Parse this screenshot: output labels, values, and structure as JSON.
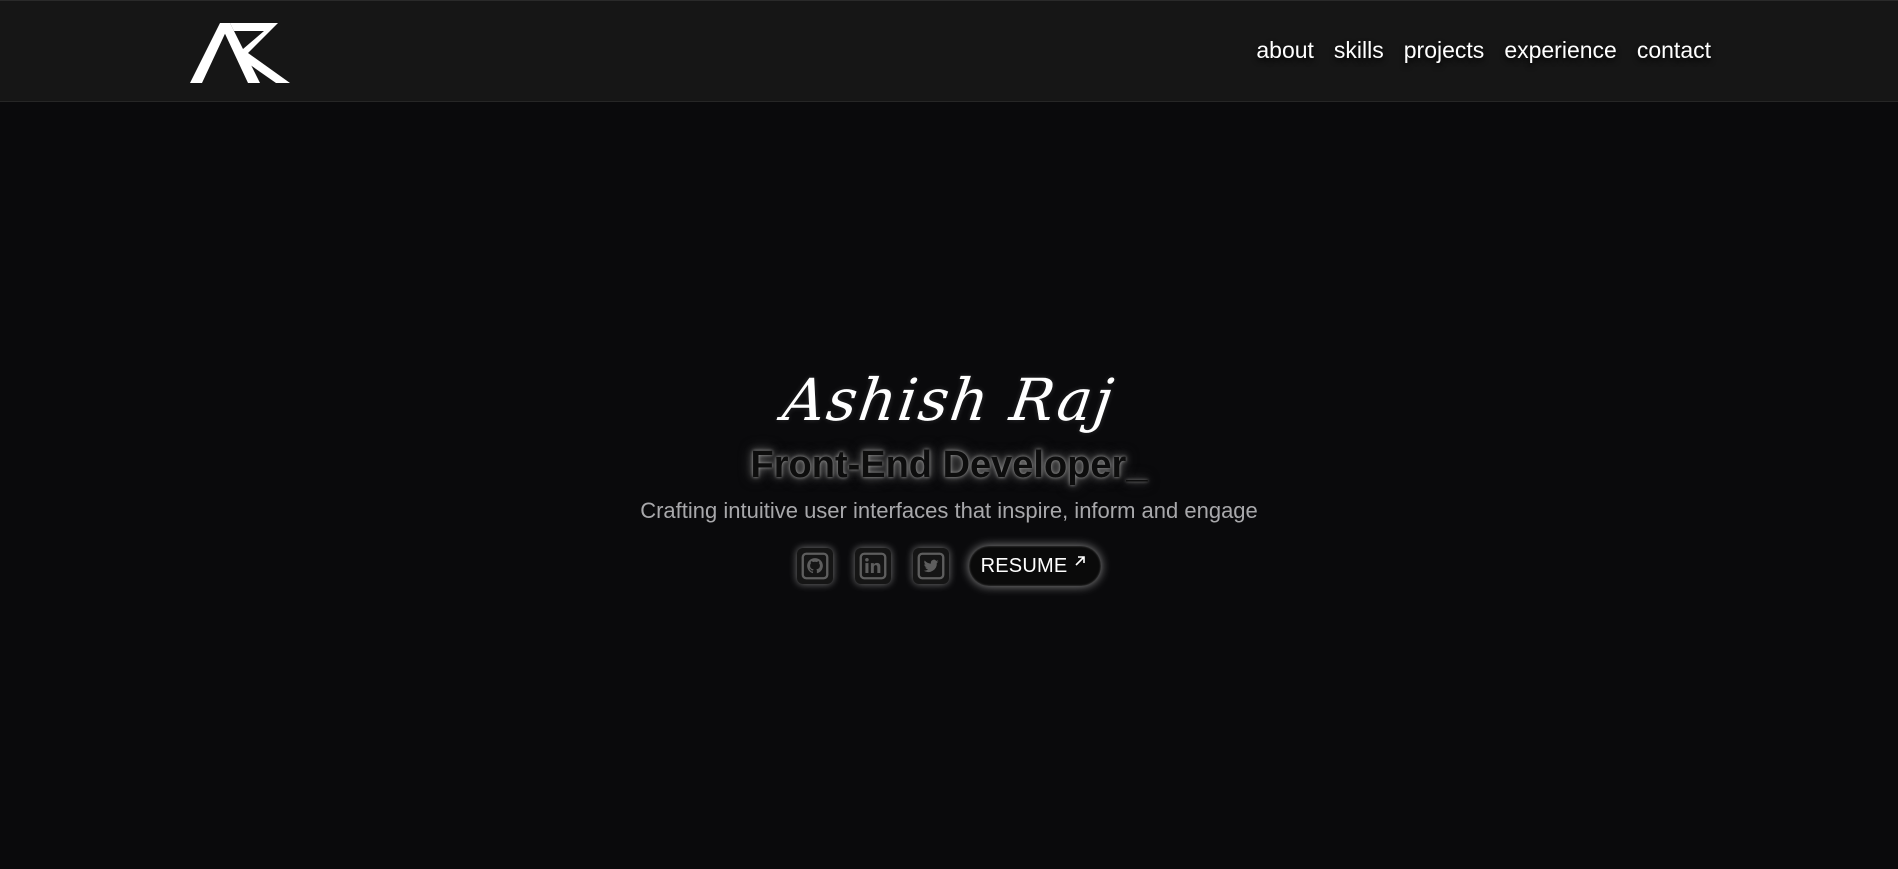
{
  "nav": {
    "logo_name": "AR-monogram-logo",
    "links": [
      "about",
      "skills",
      "projects",
      "experience",
      "contact"
    ]
  },
  "hero": {
    "name": "Ashish Raj",
    "title": "Front-End Developer_",
    "tagline": "Crafting intuitive user interfaces that inspire, inform and engage"
  },
  "social": {
    "icons": [
      "github-icon",
      "linkedin-icon",
      "twitter-icon"
    ],
    "resume_label": "RESUME",
    "resume_icon": "arrow-up-right-icon"
  },
  "colors": {
    "background": "#0a0a0c",
    "navbar": "#161616",
    "tagline": "#a8a8ab",
    "icon": "#5e5e5e"
  }
}
